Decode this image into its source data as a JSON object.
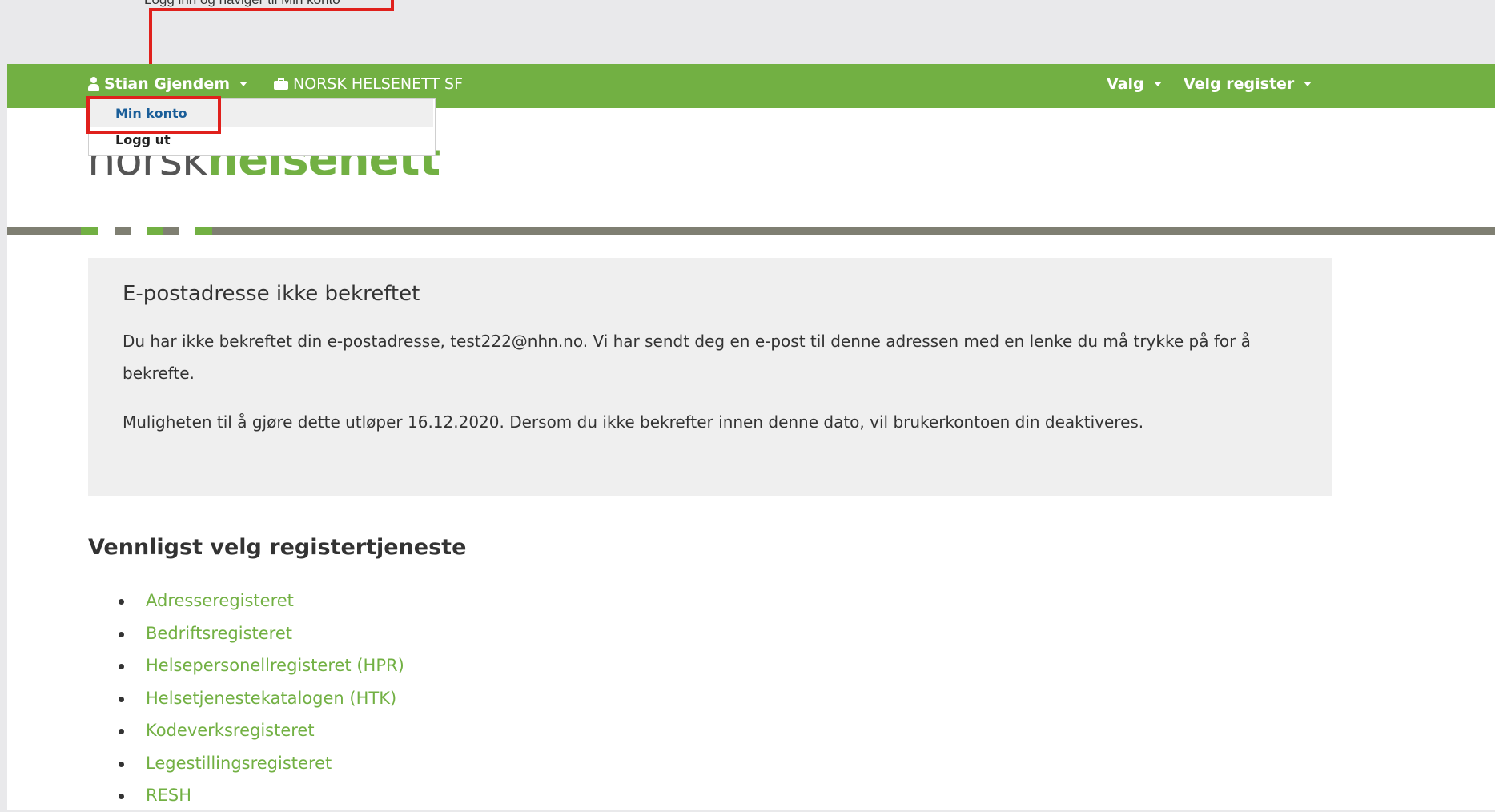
{
  "annotation": {
    "callout_text": "Logg inn og naviger til Min konto"
  },
  "navbar": {
    "user_name": "Stian Gjendem",
    "organization": "NORSK HELSENETT SF",
    "menu_valg": "Valg",
    "menu_velg_register": "Velg register",
    "colors": {
      "background": "#72b043",
      "text": "#ffffff"
    }
  },
  "user_dropdown": {
    "items": [
      {
        "label": "Min konto"
      },
      {
        "label": "Logg ut"
      }
    ]
  },
  "logo": {
    "part1": "norsk",
    "part2": "helsenett"
  },
  "alert": {
    "title": "E-postadresse ikke bekreftet",
    "paragraph1": "Du har ikke bekreftet din e-postadresse, test222@nhn.no. Vi har sendt deg en e-post til denne adressen med en lenke du må trykke på for å bekrefte.",
    "paragraph2": "Muligheten til å gjøre dette utløper 16.12.2020. Dersom du ikke bekrefter innen denne dato, vil brukerkontoen din deaktiveres."
  },
  "registers": {
    "title": "Vennligst velg registertjeneste",
    "items": [
      "Adresseregisteret",
      "Bedriftsregisteret",
      "Helsepersonellregisteret (HPR)",
      "Helsetjenestekatalogen (HTK)",
      "Kodeverksregisteret",
      "Legestillingsregisteret",
      "RESH"
    ],
    "link_color": "#72b043"
  },
  "colors": {
    "highlight": "#e0201c",
    "brand_green": "#72b043",
    "stripe_grey": "#7f7f72"
  }
}
